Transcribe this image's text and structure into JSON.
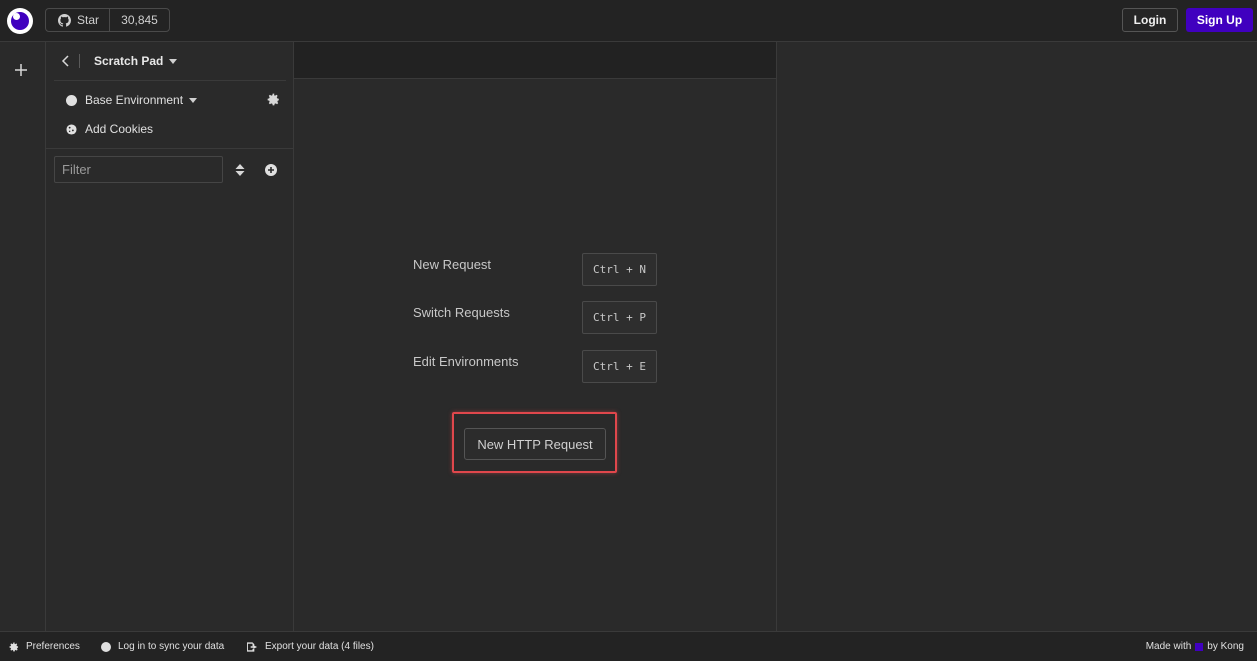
{
  "topbar": {
    "star_label": "Star",
    "star_count": "30,845",
    "login_label": "Login",
    "signup_label": "Sign Up"
  },
  "sidebar": {
    "title": "Scratch Pad",
    "environment": "Base Environment",
    "cookies": "Add Cookies",
    "filter_placeholder": "Filter"
  },
  "main": {
    "shortcuts": [
      {
        "label": "New Request",
        "keys": "Ctrl + N"
      },
      {
        "label": "Switch Requests",
        "keys": "Ctrl + P"
      },
      {
        "label": "Edit Environments",
        "keys": "Ctrl + E"
      }
    ],
    "new_http_request": "New HTTP Request"
  },
  "footer": {
    "preferences": "Preferences",
    "sync": "Log in to sync your data",
    "export": "Export your data (4 files)",
    "made_with": "Made with",
    "by": "by Kong"
  },
  "colors": {
    "brand": "#4000bf",
    "highlight": "#e0474c"
  }
}
